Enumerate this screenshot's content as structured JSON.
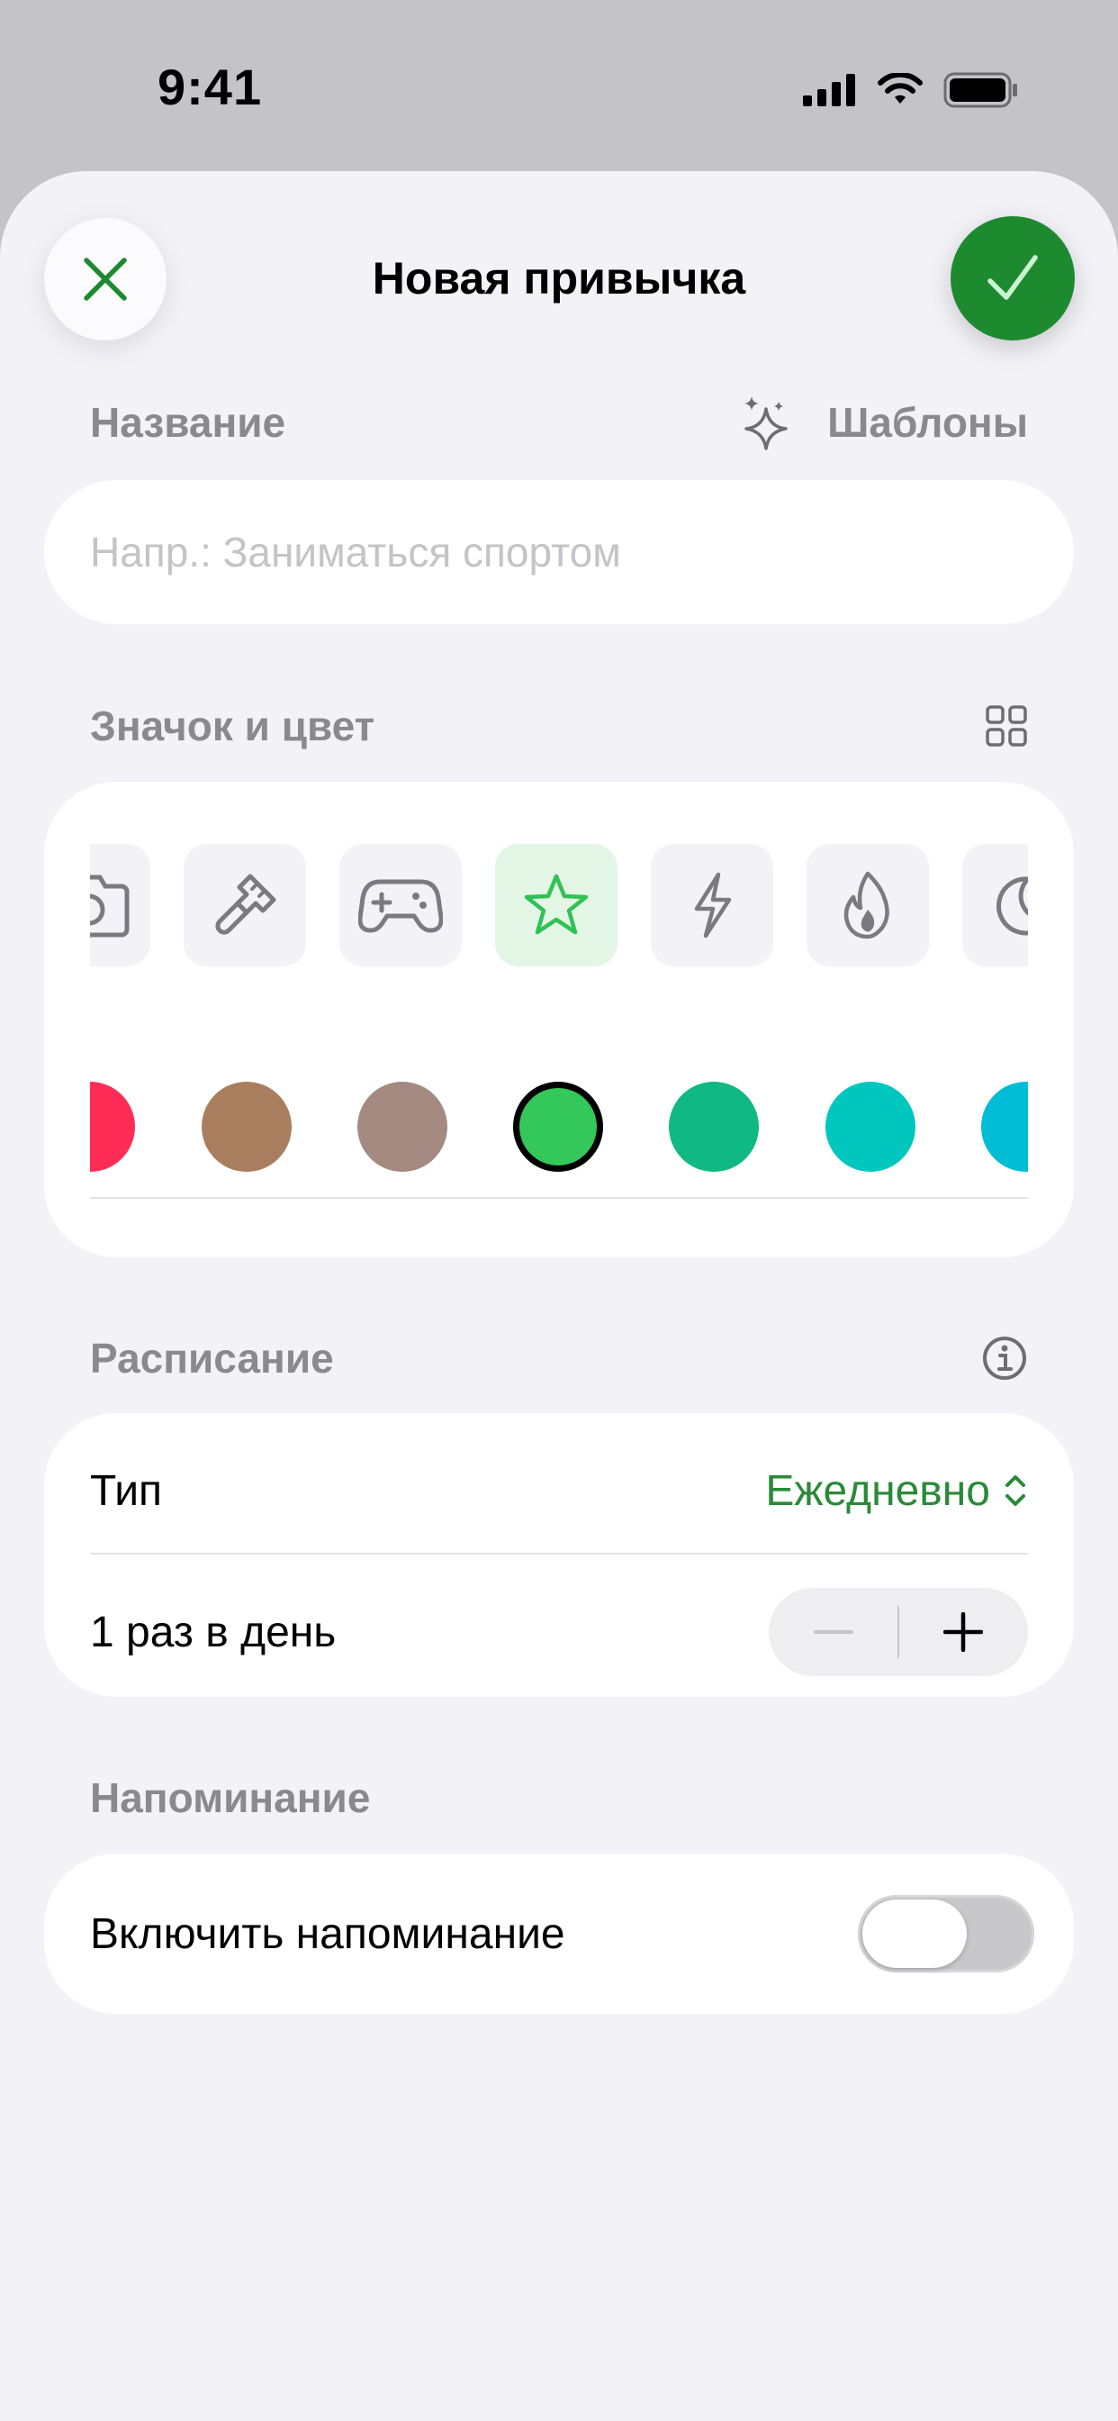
{
  "status_bar": {
    "time": "9:41"
  },
  "nav": {
    "title": "Новая привычка",
    "close_icon": "close-icon",
    "confirm_icon": "checkmark-icon"
  },
  "name_section": {
    "label": "Название",
    "templates_label": "Шаблоны",
    "templates_icon": "sparkles-icon",
    "placeholder": "Напр.: Заниматься спортом",
    "value": ""
  },
  "icon_color_section": {
    "label": "Значок и цвет",
    "grid_icon": "grid-icon",
    "icons": [
      "camera-icon",
      "paintbrush-icon",
      "gamecontroller-icon",
      "star-icon",
      "bolt-icon",
      "flame-icon",
      "moon-icon"
    ],
    "selected_icon": "star-icon",
    "colors": [
      "#ff2d55",
      "#a97e5f",
      "#a48a80",
      "#34c759",
      "#10b981",
      "#00c7be",
      "#00bcd4"
    ],
    "selected_color": "#34c759",
    "accent": "#2a8a38",
    "confirm_bg": "#1e8a30"
  },
  "schedule_section": {
    "label": "Расписание",
    "info_icon": "info-icon",
    "type_label": "Тип",
    "type_value": "Ежедневно",
    "frequency_label": "1 раз в день",
    "minus_label": "−",
    "plus_label": "+"
  },
  "reminder_section": {
    "label": "Напоминание",
    "toggle_label": "Включить напоминание",
    "enabled": false
  }
}
